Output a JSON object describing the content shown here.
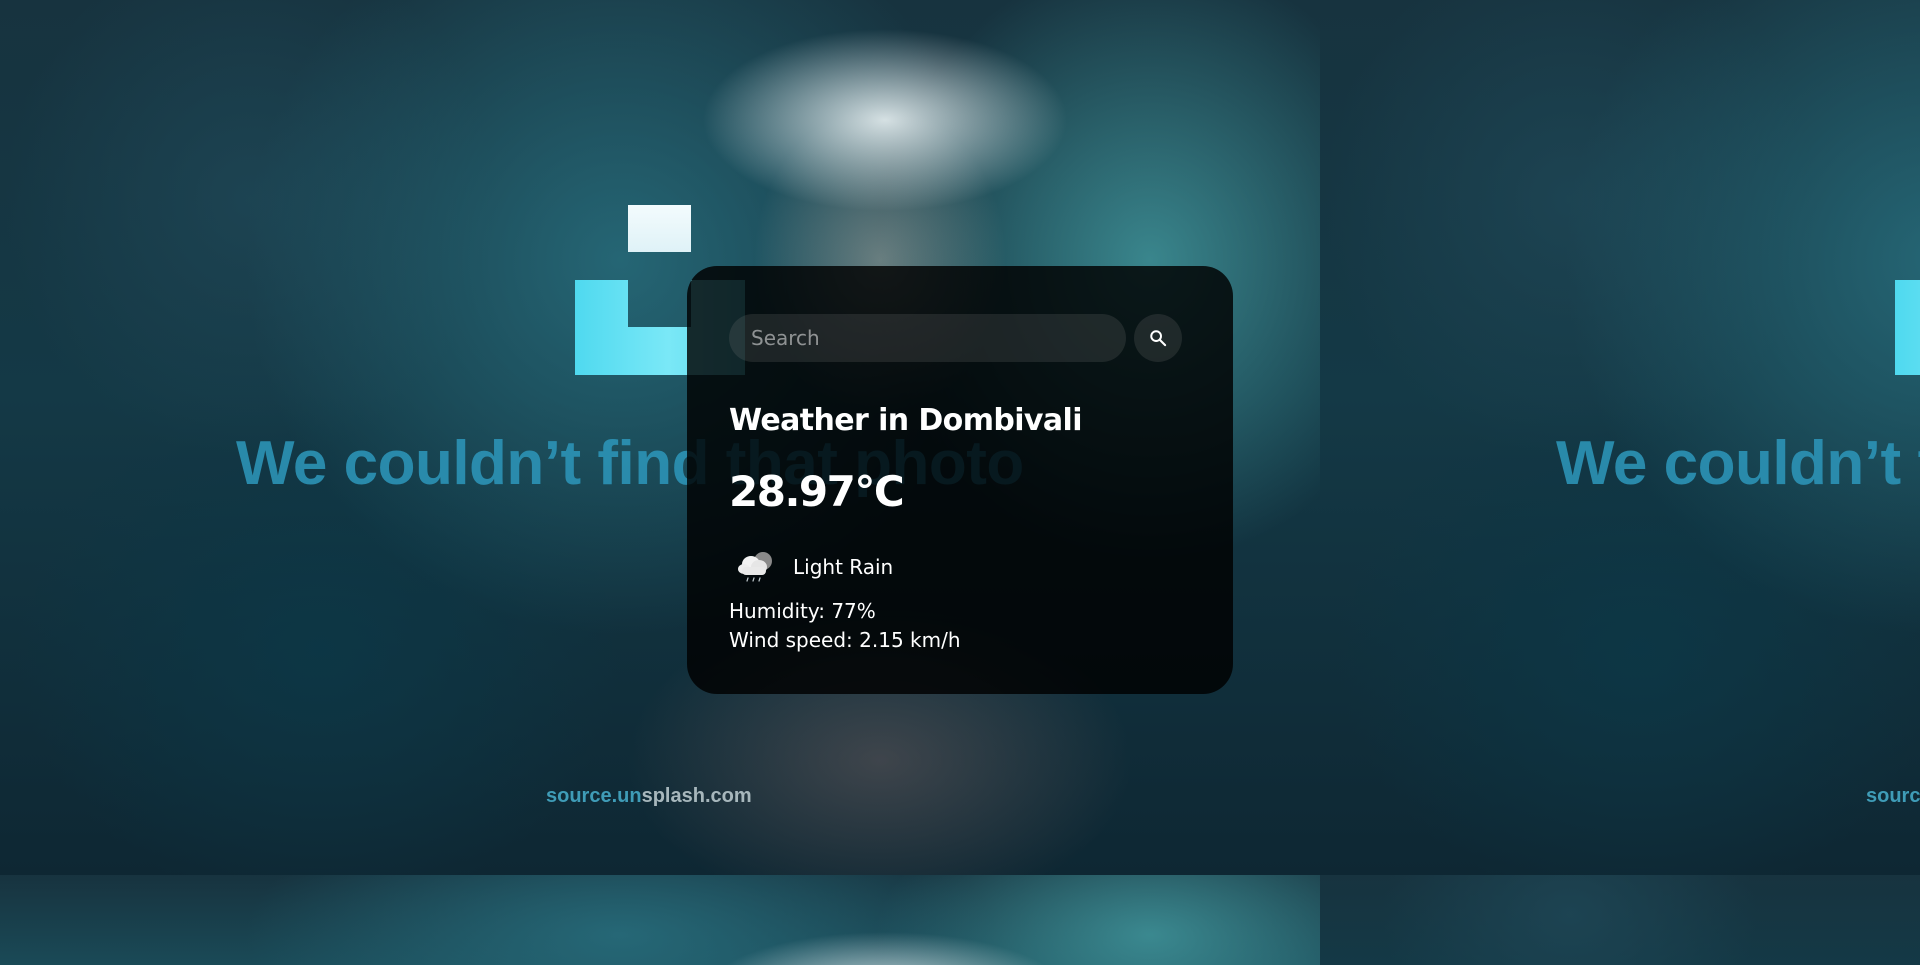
{
  "background": {
    "not_found_title": "We couldn’t find that photo",
    "source_prefix": "source.un",
    "source_suffix": "splash.com"
  },
  "search": {
    "placeholder": "Search",
    "value": "",
    "icon": "search-icon"
  },
  "weather": {
    "city_label": "Weather in Dombivali",
    "temperature": "28.97°C",
    "icon": "light-rain-cloud-icon",
    "description": "Light Rain",
    "humidity": "Humidity: 77%",
    "wind_speed": "Wind speed: 2.15 km/h"
  },
  "colors": {
    "card_background": "#000000",
    "text": "#ffffff",
    "bg_title": "#2c93b6",
    "bg_source": "#3f9cb7"
  }
}
